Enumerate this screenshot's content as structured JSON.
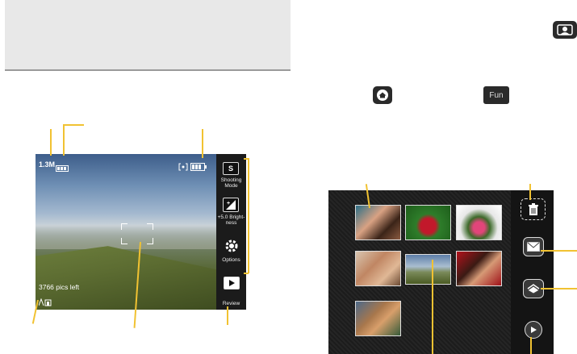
{
  "viewfinder": {
    "resolution": "1.3M",
    "storage": "Built-in memory",
    "pictures_left": "3766 pics left",
    "sidebar": [
      {
        "id": "shooting-mode",
        "icon": "shooting-mode-icon",
        "label": "Shooting Mode",
        "glyph": "S"
      },
      {
        "id": "brightness",
        "icon": "brightness-icon",
        "label": "+5.0 Bright- ness",
        "glyph": "±"
      },
      {
        "id": "options",
        "icon": "options-gear-icon",
        "label": "Options",
        "glyph": "⚙"
      },
      {
        "id": "review",
        "icon": "review-play-icon",
        "label": "Review",
        "glyph": "▶"
      }
    ]
  },
  "fun_button": "Fun",
  "gallery": {
    "thumbnails": [
      "friends",
      "red-flowers",
      "pink-flower",
      "family",
      "landscape",
      "couple",
      "group"
    ],
    "side_icons": [
      "trash-icon",
      "mail-icon",
      "album-icon",
      "play-icon"
    ]
  },
  "colors": {
    "callout": "#f1c232",
    "panel_dark": "#1e1e1e"
  }
}
